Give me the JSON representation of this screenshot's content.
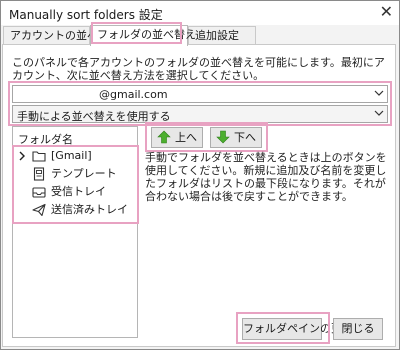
{
  "window": {
    "title": "Manually sort folders 設定",
    "close_glyph": "✕"
  },
  "tabs": [
    {
      "label": "アカウントの並べ替え"
    },
    {
      "label": "フォルダの並べ替え"
    },
    {
      "label": "追加設定"
    }
  ],
  "description": "このパネルで各アカウントのフォルダの並べ替えを可能にします。最初にアカウント、次に並べ替え方法を選択してください。",
  "account_select": {
    "value": "@gmail.com"
  },
  "sort_method_select": {
    "value": "手動による並べ替えを使用する"
  },
  "folder_list": {
    "header": "フォルダ名",
    "items": [
      {
        "label": "[Gmail]",
        "icon": "folder-icon",
        "expander": "chevron-right-icon"
      },
      {
        "label": "テンプレート",
        "icon": "template-icon"
      },
      {
        "label": "受信トレイ",
        "icon": "inbox-icon"
      },
      {
        "label": "送信済みトレイ",
        "icon": "sent-icon"
      }
    ]
  },
  "buttons": {
    "up": "上へ",
    "down": "下へ",
    "refresh": "フォルダペインの更新",
    "close": "閉じる"
  },
  "info_text": "手動でフォルダを並べ替えるときは上のボタンを使用してください。新規に追加及び名前を変更したフォルダはリストの最下段になります。それが合わない場合は後で戻すことができます。",
  "colors": {
    "highlight": "#e8a2c2",
    "arrow_green": "#4caf2e"
  }
}
